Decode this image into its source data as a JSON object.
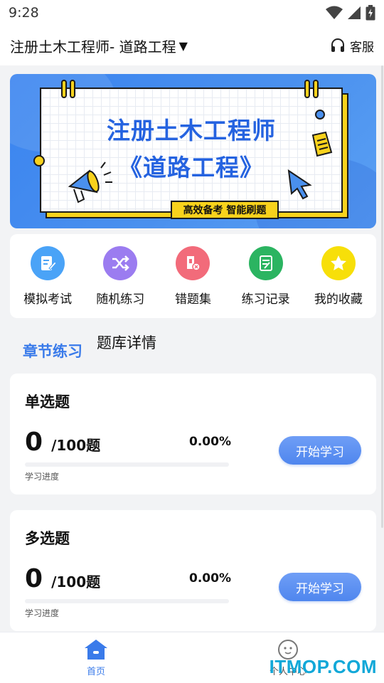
{
  "status_bar": {
    "time": "9:28",
    "icons": [
      "wifi-icon",
      "signal-icon",
      "battery-icon"
    ]
  },
  "header": {
    "title": "注册土木工程师- 道路工程",
    "caret": "▼",
    "service_label": "客服"
  },
  "banner": {
    "title_line1": "注册土木工程师",
    "title_line2": "《道路工程》",
    "tag": "高效备考 智能刷题"
  },
  "quick_actions": [
    {
      "label": "模拟考试",
      "icon": "exam-doc-icon",
      "color": "#4aa3f7"
    },
    {
      "label": "随机练习",
      "icon": "shuffle-icon",
      "color": "#9b7cf0"
    },
    {
      "label": "错题集",
      "icon": "wrong-book-icon",
      "color": "#f26b7a"
    },
    {
      "label": "练习记录",
      "icon": "record-icon",
      "color": "#2bb461"
    },
    {
      "label": "我的收藏",
      "icon": "star-icon",
      "color": "#f7df09"
    }
  ],
  "tabs": {
    "active": "章节练习",
    "other": "题库详情"
  },
  "cards": [
    {
      "title": "单选题",
      "done": "0",
      "total": "/100题",
      "percent": "0.00%",
      "progress": 0.0,
      "progress_label": "学习进度",
      "button": "开始学习"
    },
    {
      "title": "多选题",
      "done": "0",
      "total": "/100题",
      "percent": "0.00%",
      "progress": 0.0,
      "progress_label": "学习进度",
      "button": "开始学习"
    }
  ],
  "bottom_nav": {
    "home_label": "首页",
    "profile_label": "个人中心"
  },
  "watermark": "ITMOP.COM",
  "colors": {
    "accent": "#3a7bea",
    "banner_blue": "#4a90ee",
    "banner_yellow": "#f8d21c"
  }
}
